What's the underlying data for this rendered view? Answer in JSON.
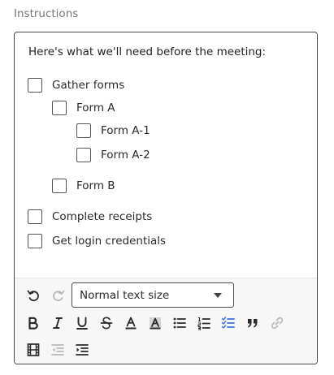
{
  "field": {
    "label": "Instructions"
  },
  "editor": {
    "intro": "Here's what we'll need before the meeting:",
    "tasks": [
      {
        "label": "Gather forms",
        "checked": false,
        "level": 0
      },
      {
        "label": "Form A",
        "checked": false,
        "level": 1
      },
      {
        "label": "Form A-1",
        "checked": false,
        "level": 2
      },
      {
        "label": "Form A-2",
        "checked": false,
        "level": 2
      },
      {
        "label": "Form B",
        "checked": false,
        "level": 1
      },
      {
        "label": "Complete receipts",
        "checked": false,
        "level": 0
      },
      {
        "label": "Get login credentials",
        "checked": false,
        "level": 0
      }
    ]
  },
  "toolbar": {
    "text_style": {
      "selected": "Normal text size"
    },
    "buttons": [
      {
        "name": "undo",
        "icon": "undo-icon",
        "enabled": true
      },
      {
        "name": "redo",
        "icon": "redo-icon",
        "enabled": false
      },
      {
        "name": "bold",
        "icon": "bold-icon",
        "enabled": true
      },
      {
        "name": "italic",
        "icon": "italic-icon",
        "enabled": true
      },
      {
        "name": "underline",
        "icon": "underline-icon",
        "enabled": true
      },
      {
        "name": "strikethrough",
        "icon": "strikethrough-icon",
        "enabled": true
      },
      {
        "name": "text-color",
        "icon": "text-color-icon",
        "enabled": true
      },
      {
        "name": "highlight",
        "icon": "highlight-icon",
        "enabled": true
      },
      {
        "name": "bulleted-list",
        "icon": "bulleted-list-icon",
        "enabled": true
      },
      {
        "name": "numbered-list",
        "icon": "numbered-list-icon",
        "enabled": true
      },
      {
        "name": "checklist",
        "icon": "checklist-icon",
        "enabled": true,
        "active": true
      },
      {
        "name": "quote",
        "icon": "quote-icon",
        "enabled": true
      },
      {
        "name": "link",
        "icon": "link-icon",
        "enabled": false
      },
      {
        "name": "embed-media",
        "icon": "film-icon",
        "enabled": true
      },
      {
        "name": "outdent",
        "icon": "outdent-icon",
        "enabled": false
      },
      {
        "name": "indent",
        "icon": "indent-icon",
        "enabled": true
      }
    ]
  },
  "colors": {
    "text": "#2a2a2a",
    "muted_label": "#777777",
    "border": "#4a4a4a",
    "toolbar_bg": "#f7f7f7",
    "active_accent": "#3b6fd8",
    "disabled_icon": "#b9b9b9"
  }
}
